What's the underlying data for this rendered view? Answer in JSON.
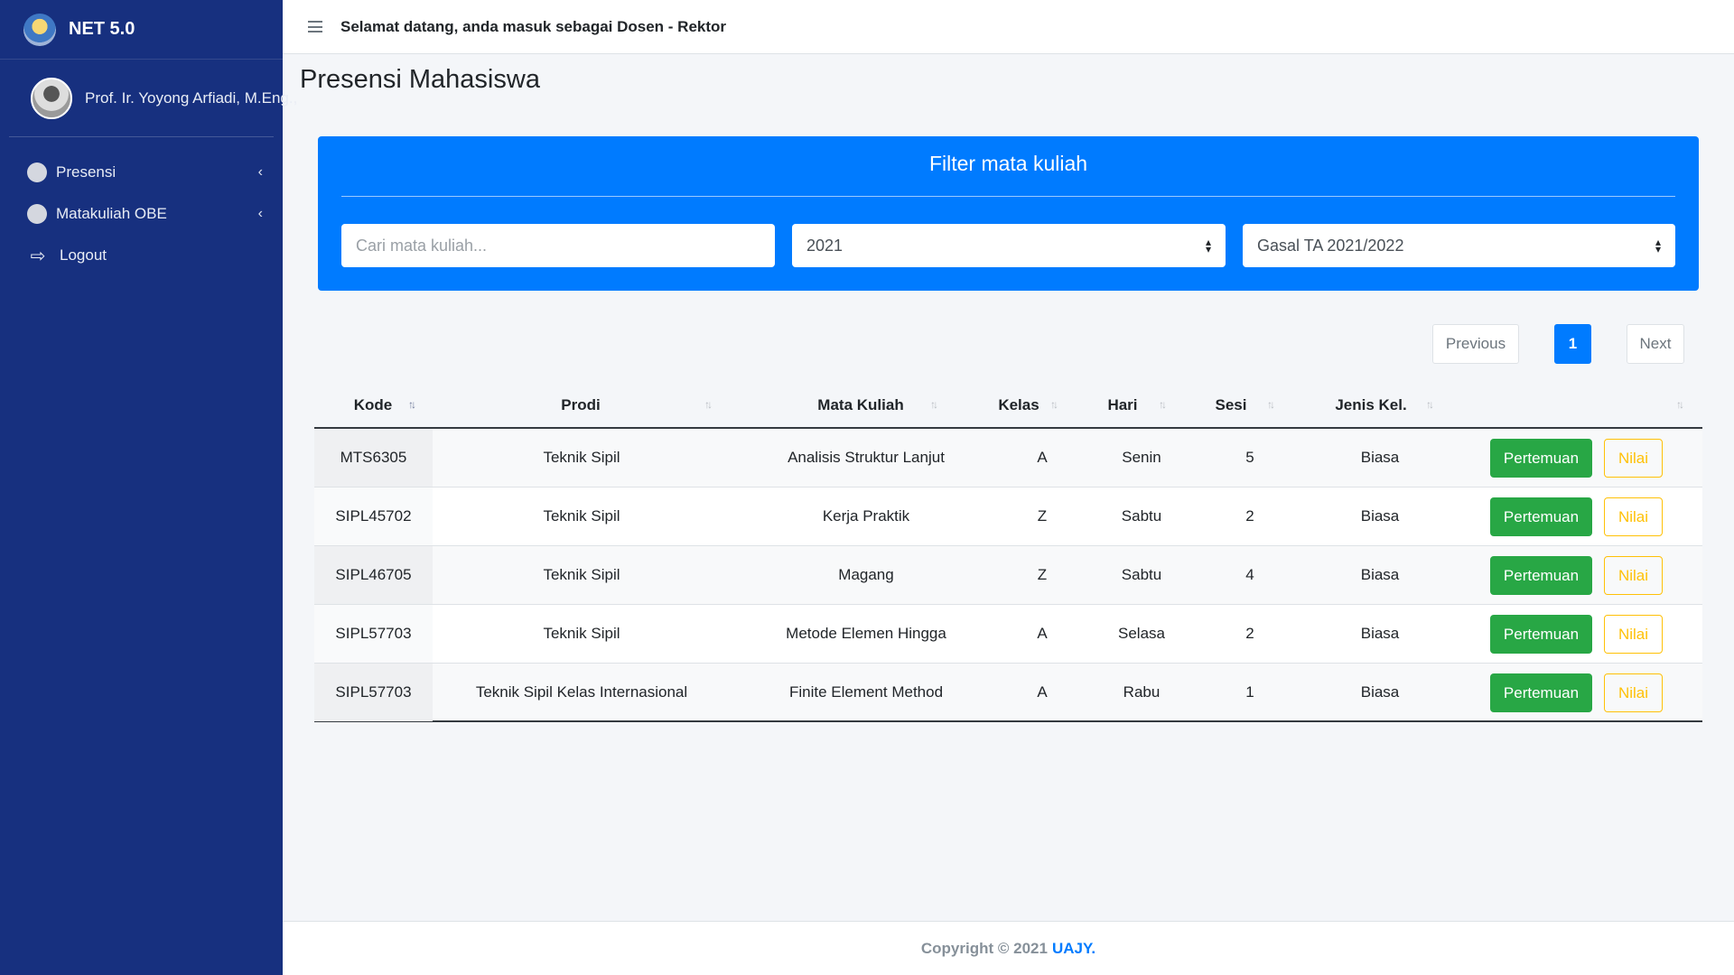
{
  "sidebar": {
    "brand": "NET 5.0",
    "user_name": "Prof. Ir. Yoyong Arfiadi, M.Eng.,",
    "nav": [
      {
        "label": "Presensi",
        "icon": "circle-icon"
      },
      {
        "label": "Matakuliah OBE",
        "icon": "circle-icon"
      },
      {
        "label": "Logout",
        "icon": "logout-icon"
      }
    ]
  },
  "topbar": {
    "welcome": "Selamat datang, anda masuk sebagai Dosen - Rektor"
  },
  "main": {
    "page_title": "Presensi Mahasiswa",
    "filter": {
      "title": "Filter mata kuliah",
      "search_placeholder": "Cari mata kuliah...",
      "search_value": "",
      "year_selected": "2021",
      "semester_selected": "Gasal TA 2021/2022"
    },
    "pagination": {
      "previous": "Previous",
      "current": "1",
      "next": "Next"
    },
    "table": {
      "headers": [
        "Kode",
        "Prodi",
        "Mata Kuliah",
        "Kelas",
        "Hari",
        "Sesi",
        "Jenis Kel.",
        ""
      ],
      "action_labels": {
        "pertemuan": "Pertemuan",
        "nilai": "Nilai"
      },
      "rows": [
        {
          "kode": "MTS6305",
          "prodi": "Teknik Sipil",
          "matkul": "Analisis Struktur Lanjut",
          "kelas": "A",
          "hari": "Senin",
          "sesi": "5",
          "jenis": "Biasa"
        },
        {
          "kode": "SIPL45702",
          "prodi": "Teknik Sipil",
          "matkul": "Kerja Praktik",
          "kelas": "Z",
          "hari": "Sabtu",
          "sesi": "2",
          "jenis": "Biasa"
        },
        {
          "kode": "SIPL46705",
          "prodi": "Teknik Sipil",
          "matkul": "Magang",
          "kelas": "Z",
          "hari": "Sabtu",
          "sesi": "4",
          "jenis": "Biasa"
        },
        {
          "kode": "SIPL57703",
          "prodi": "Teknik Sipil",
          "matkul": "Metode Elemen Hingga",
          "kelas": "A",
          "hari": "Selasa",
          "sesi": "2",
          "jenis": "Biasa"
        },
        {
          "kode": "SIPL57703",
          "prodi": "Teknik Sipil Kelas Internasional",
          "matkul": "Finite Element Method",
          "kelas": "A",
          "hari": "Rabu",
          "sesi": "1",
          "jenis": "Biasa"
        }
      ]
    }
  },
  "footer": {
    "copyright": "Copyright © 2021",
    "link": "UAJY."
  },
  "colors": {
    "sidebar": "#17307f",
    "primary": "#007bff",
    "success": "#28a745",
    "warning": "#ffc107"
  }
}
